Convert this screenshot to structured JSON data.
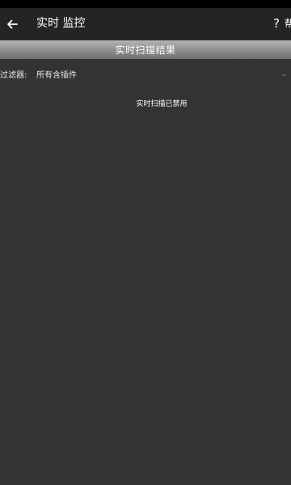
{
  "app_bar": {
    "back_icon": "arrow-left-icon",
    "title": "实时 监控",
    "help_label": "?",
    "overflow_label": "帮"
  },
  "results_header": {
    "label": "实时扫描结果"
  },
  "filter": {
    "label": "过滤器:",
    "selected": "所有含插件",
    "dropdown_icon": "triangle-down-icon"
  },
  "status_message": "实时扫描已禁用",
  "colors": {
    "background": "#333333",
    "app_bar": "#242424",
    "status_bar": "#000000",
    "header_gradient_top": "#b4b4b4",
    "header_gradient_bottom": "#6f6f6f",
    "text": "#ffffff"
  }
}
